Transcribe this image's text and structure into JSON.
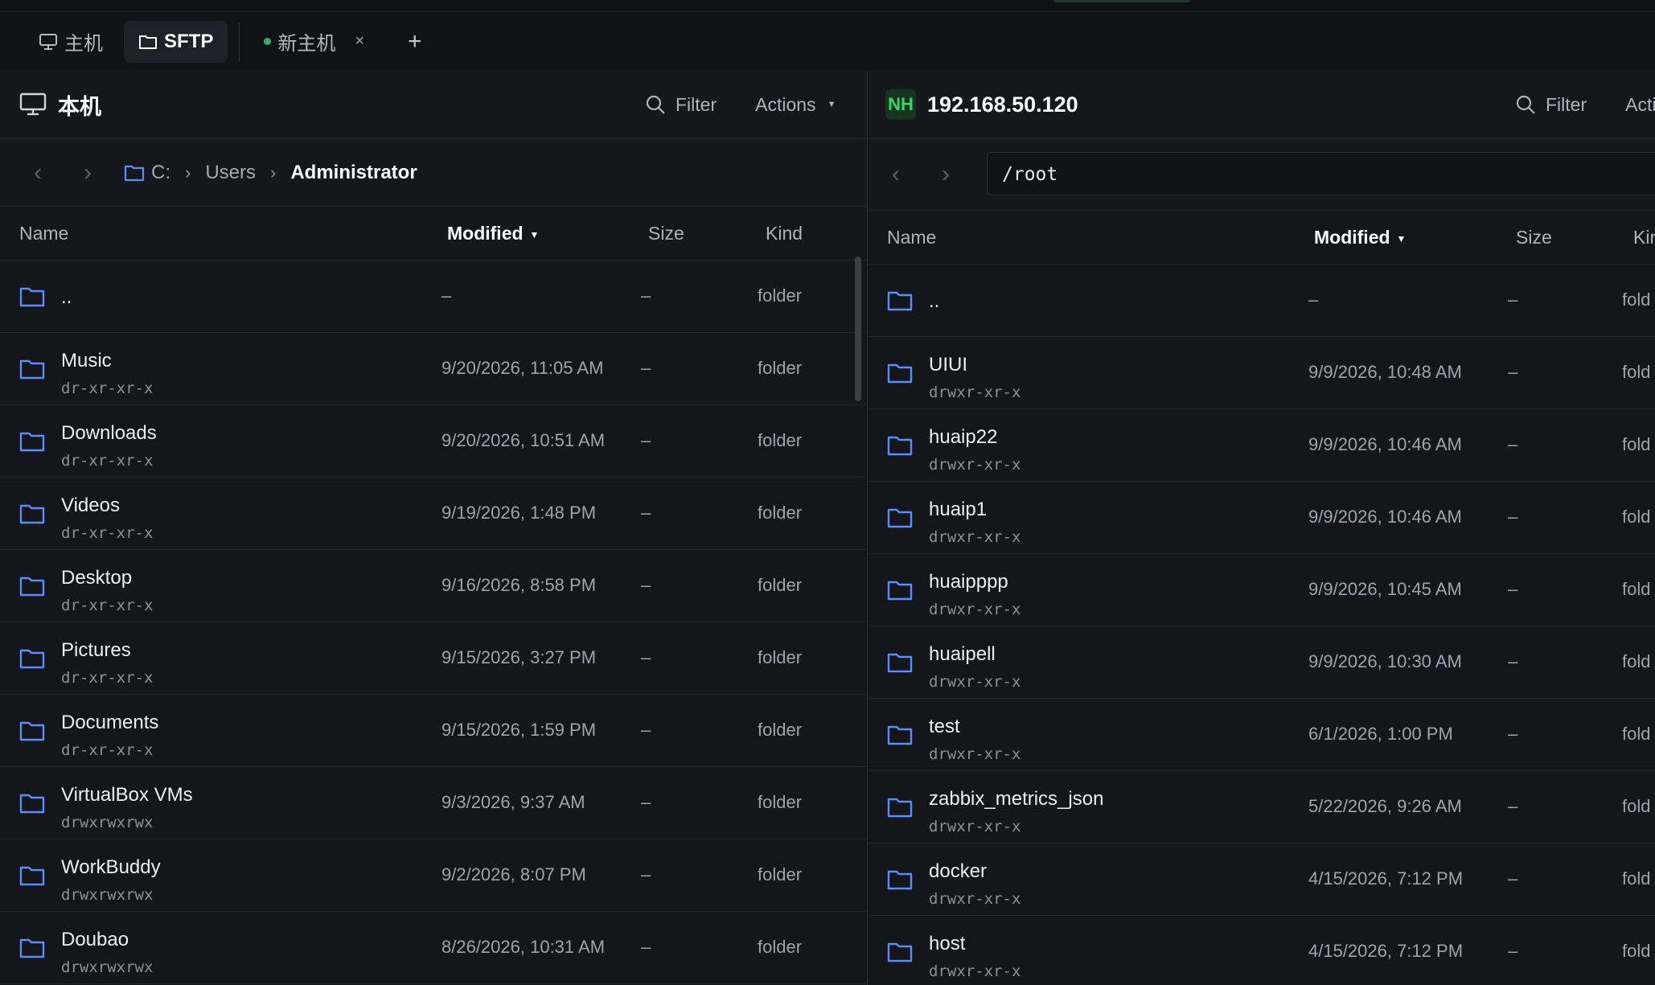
{
  "tabs": [
    {
      "label": "主机",
      "icon": "monitor-icon",
      "active": false
    },
    {
      "label": "SFTP",
      "icon": "folder-icon",
      "active": true
    },
    {
      "label": "新主机",
      "status": "connected",
      "close": "×",
      "active": false
    }
  ],
  "add_tab": "+",
  "local": {
    "title": "本机",
    "filter": "Filter",
    "actions": "Actions",
    "breadcrumb": [
      "C:",
      "Users",
      "Administrator"
    ],
    "columns": {
      "name": "Name",
      "modified": "Modified",
      "size": "Size",
      "kind": "Kind"
    },
    "rows": [
      {
        "name": "..",
        "perm": "",
        "modified": "–",
        "size": "–",
        "kind": "folder"
      },
      {
        "name": "Music",
        "perm": "dr-xr-xr-x",
        "modified": "9/20/2026, 11:05 AM",
        "size": "–",
        "kind": "folder"
      },
      {
        "name": "Downloads",
        "perm": "dr-xr-xr-x",
        "modified": "9/20/2026, 10:51 AM",
        "size": "–",
        "kind": "folder"
      },
      {
        "name": "Videos",
        "perm": "dr-xr-xr-x",
        "modified": "9/19/2026, 1:48 PM",
        "size": "–",
        "kind": "folder"
      },
      {
        "name": "Desktop",
        "perm": "dr-xr-xr-x",
        "modified": "9/16/2026, 8:58 PM",
        "size": "–",
        "kind": "folder"
      },
      {
        "name": "Pictures",
        "perm": "dr-xr-xr-x",
        "modified": "9/15/2026, 3:27 PM",
        "size": "–",
        "kind": "folder"
      },
      {
        "name": "Documents",
        "perm": "dr-xr-xr-x",
        "modified": "9/15/2026, 1:59 PM",
        "size": "–",
        "kind": "folder"
      },
      {
        "name": "VirtualBox VMs",
        "perm": "drwxrwxrwx",
        "modified": "9/3/2026, 9:37 AM",
        "size": "–",
        "kind": "folder"
      },
      {
        "name": "WorkBuddy",
        "perm": "drwxrwxrwx",
        "modified": "9/2/2026, 8:07 PM",
        "size": "–",
        "kind": "folder"
      },
      {
        "name": "Doubao",
        "perm": "drwxrwxrwx",
        "modified": "8/26/2026, 10:31 AM",
        "size": "–",
        "kind": "folder"
      }
    ]
  },
  "remote": {
    "badge": "NH",
    "host": "192.168.50.120",
    "filter": "Filter",
    "actions": "Acti",
    "path": "/root",
    "columns": {
      "name": "Name",
      "modified": "Modified",
      "size": "Size",
      "kind": "Kir"
    },
    "rows": [
      {
        "name": "..",
        "perm": "",
        "modified": "–",
        "size": "–",
        "kind": "fold"
      },
      {
        "name": "UIUI",
        "perm": "drwxr-xr-x",
        "modified": "9/9/2026, 10:48 AM",
        "size": "–",
        "kind": "fold"
      },
      {
        "name": "huaip22",
        "perm": "drwxr-xr-x",
        "modified": "9/9/2026, 10:46 AM",
        "size": "–",
        "kind": "fold"
      },
      {
        "name": "huaip1",
        "perm": "drwxr-xr-x",
        "modified": "9/9/2026, 10:46 AM",
        "size": "–",
        "kind": "fold"
      },
      {
        "name": "huaipppp",
        "perm": "drwxr-xr-x",
        "modified": "9/9/2026, 10:45 AM",
        "size": "–",
        "kind": "fold"
      },
      {
        "name": "huaipell",
        "perm": "drwxr-xr-x",
        "modified": "9/9/2026, 10:30 AM",
        "size": "–",
        "kind": "fold"
      },
      {
        "name": "test",
        "perm": "drwxr-xr-x",
        "modified": "6/1/2026, 1:00 PM",
        "size": "–",
        "kind": "fold"
      },
      {
        "name": "zabbix_metrics_json",
        "perm": "drwxr-xr-x",
        "modified": "5/22/2026, 9:26 AM",
        "size": "–",
        "kind": "fold"
      },
      {
        "name": "docker",
        "perm": "drwxr-xr-x",
        "modified": "4/15/2026, 7:12 PM",
        "size": "–",
        "kind": "fold"
      },
      {
        "name": "host",
        "perm": "drwxr-xr-x",
        "modified": "4/15/2026, 7:12 PM",
        "size": "–",
        "kind": "fold"
      }
    ]
  },
  "colors": {
    "folder": "#5b8cf7",
    "accent_green": "#3ed36f",
    "background": "#14161c"
  }
}
